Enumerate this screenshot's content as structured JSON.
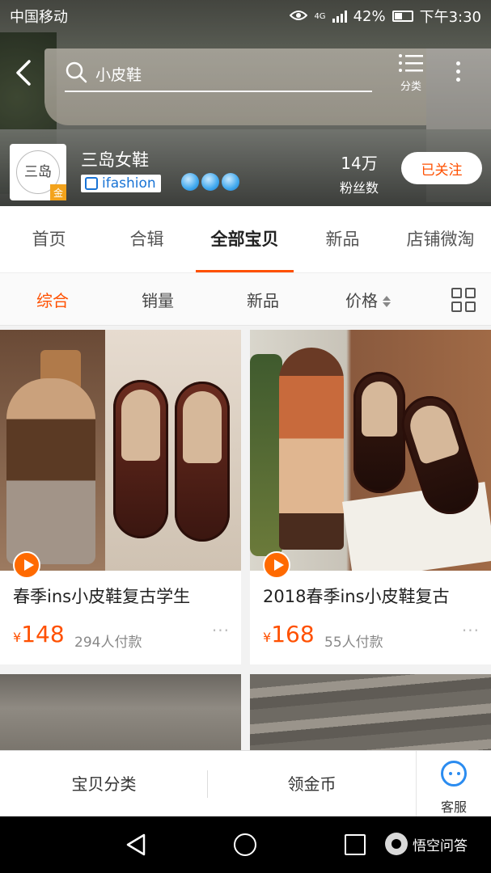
{
  "status_bar": {
    "carrier": "中国移动",
    "network": "4G",
    "battery": "42%",
    "time": "下午3:30"
  },
  "top_bar": {
    "search_text": "小皮鞋",
    "category_label": "分类"
  },
  "shop": {
    "logo_text": "三岛",
    "gold_badge": "金",
    "name": "三岛女鞋",
    "tag": "ifashion",
    "fans_count": "14万",
    "fans_label": "粉丝数",
    "follow_label": "已关注",
    "crown_count": 3
  },
  "tabs": [
    {
      "label": "首页"
    },
    {
      "label": "合辑"
    },
    {
      "label": "全部宝贝",
      "active": true
    },
    {
      "label": "新品"
    },
    {
      "label": "店铺微淘"
    }
  ],
  "sort_options": [
    {
      "label": "综合",
      "active": true
    },
    {
      "label": "销量"
    },
    {
      "label": "新品"
    },
    {
      "label": "价格"
    }
  ],
  "products": [
    {
      "title": "春季ins小皮鞋复古学生",
      "currency": "¥",
      "price": "148",
      "sold": "294人付款",
      "has_video": true
    },
    {
      "title": "2018春季ins小皮鞋复古",
      "currency": "¥",
      "price": "168",
      "sold": "55人付款",
      "has_video": true
    }
  ],
  "action_bar": {
    "category": "宝贝分类",
    "coins": "领金币",
    "service": "客服"
  },
  "watermark": "悟空问答",
  "colors": {
    "accent": "#ff5000",
    "service_blue": "#2b8cf0"
  }
}
